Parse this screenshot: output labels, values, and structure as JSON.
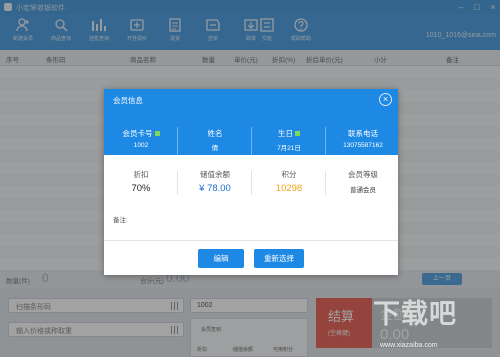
{
  "app": {
    "title": "小宏掌收银软件"
  },
  "toolbar": {
    "items": [
      {
        "label": "新建会员",
        "icon": "member-add-icon"
      },
      {
        "label": "商品查询",
        "icon": "product-search-icon"
      },
      {
        "label": "挂售查询",
        "icon": "sale-query-icon"
      },
      {
        "label": "开挂调价",
        "icon": "price-adjust-icon"
      },
      {
        "label": "退货",
        "icon": "return-icon"
      },
      {
        "label": "挂单",
        "icon": "hold-order-icon"
      },
      {
        "label": "取单",
        "icon": "retrieve-order-icon"
      },
      {
        "label": "交班",
        "icon": "shift-icon"
      },
      {
        "label": "帮助帮助",
        "icon": "help-icon"
      }
    ],
    "user": "1010_1016@sina.com"
  },
  "grid": {
    "columns": [
      "序号",
      "条形码",
      "商品名称",
      "数量",
      "单价(元)",
      "折扣(%)",
      "折后单价(元)",
      "小计",
      "备注"
    ]
  },
  "summary": {
    "qty_label": "数量(件)",
    "qty_value": "0",
    "total_label": "合计(元)",
    "total_value": "0.00",
    "prev_page_label": "上一页"
  },
  "bottom": {
    "scan_placeholder": "扫描条形码",
    "manual_placeholder": "输入价格或称取重",
    "card_value": "1002",
    "member_label": "会员签到",
    "discount_label": "折扣",
    "stored_label": "储值余额",
    "points_label": "可用积分",
    "checkout_label": "结算",
    "checkout_sub": "(空格键)",
    "amount_label": "金额",
    "amount_value": "0.00"
  },
  "modal": {
    "title": "会员信息",
    "info": [
      {
        "label": "会员卡号",
        "value": "1002",
        "flag": true
      },
      {
        "label": "姓名",
        "value": "倩",
        "flag": false
      },
      {
        "label": "生日",
        "value": "7月21日",
        "flag": true
      },
      {
        "label": "联系电话",
        "value": "13075587162",
        "flag": false
      }
    ],
    "stats": [
      {
        "label": "折扣",
        "value": "70%",
        "color": "#222222"
      },
      {
        "label": "储值余额",
        "value": "¥ 78.00",
        "color": "#1e6fd0"
      },
      {
        "label": "积分",
        "value": "10298",
        "color": "#f0a21b"
      },
      {
        "label": "会员等级",
        "value": "普通会员",
        "color": "#333333"
      }
    ],
    "note_label": "备注:",
    "edit_button": "编辑",
    "reselect_button": "重新选择"
  },
  "watermark": {
    "text": "下载吧",
    "url": "www.xiazaiba.com"
  },
  "colors": {
    "primary": "#1e88e5",
    "points": "#f0a21b",
    "balance": "#1e6fd0",
    "checkout": "#e44c3c"
  }
}
